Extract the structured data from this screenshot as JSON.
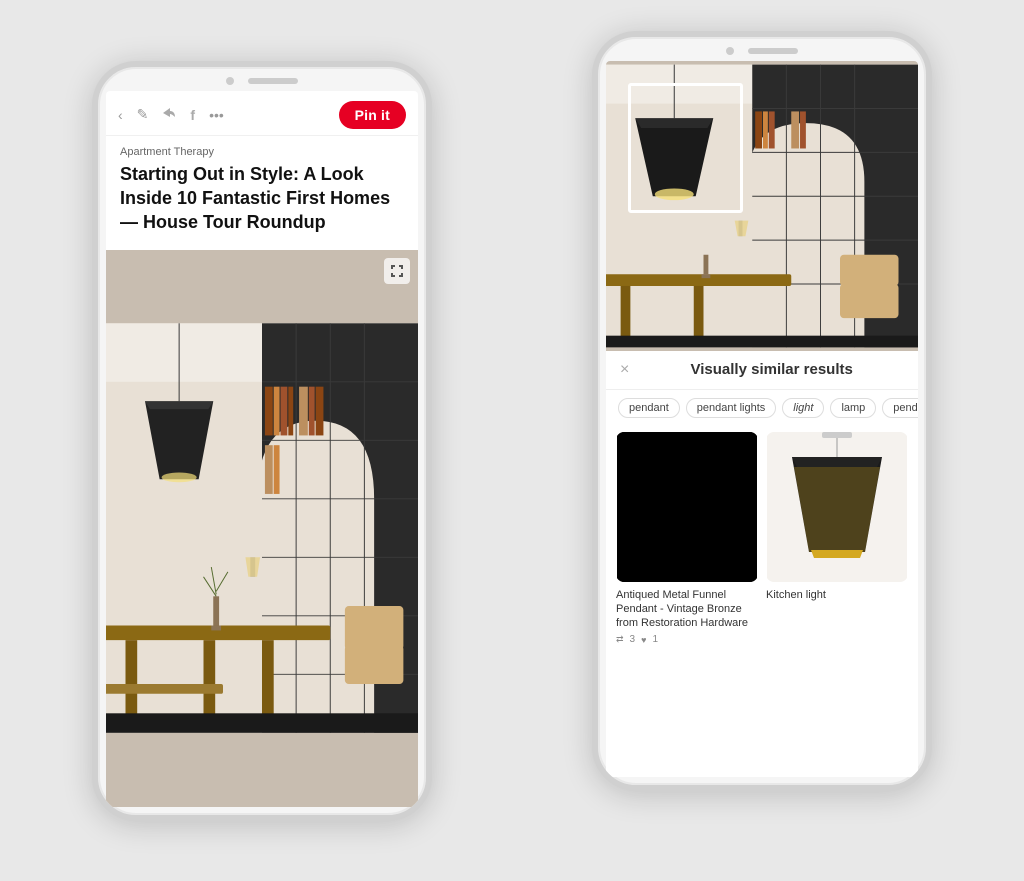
{
  "left_phone": {
    "toolbar": {
      "pin_it_label": "Pin it",
      "back_icon": "‹",
      "edit_icon": "✎",
      "share_icon": "✈",
      "facebook_icon": "f",
      "more_icon": "•••"
    },
    "article": {
      "source": "Apartment Therapy",
      "title": "Starting Out in Style: A Look Inside 10 Fantastic First Homes — House Tour Roundup"
    },
    "zoom_icon": "⊡"
  },
  "right_phone": {
    "similar_results": {
      "title": "Visually similar results",
      "close_icon": "×",
      "tags": [
        "pendant",
        "pendant lights",
        "light",
        "lamp",
        "pendant lamps"
      ],
      "results": [
        {
          "title": "Antiqued Metal Funnel Pendant - Vintage Bronze from Restoration Hardware",
          "likes": "3",
          "repins": "1"
        },
        {
          "title": "Kitchen light",
          "likes": "",
          "repins": ""
        }
      ]
    }
  },
  "colors": {
    "pin_red": "#e60023",
    "bg_gray": "#e8e8e8",
    "phone_bg": "#f5f5f5",
    "phone_border": "#d0d0d0",
    "tag_border": "#ddd",
    "text_dark": "#111",
    "text_medium": "#333",
    "text_light": "#666",
    "text_muted": "#999"
  }
}
